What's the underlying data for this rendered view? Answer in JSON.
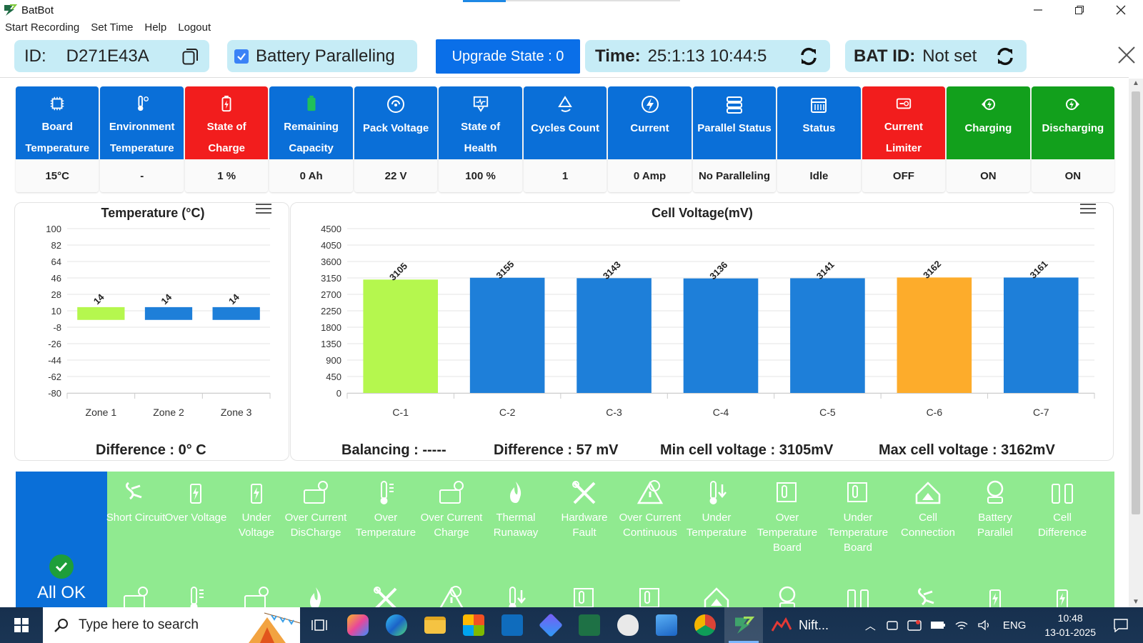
{
  "window": {
    "title": "BatBot"
  },
  "menu": [
    "Start Recording",
    "Set Time",
    "Help",
    "Logout"
  ],
  "header": {
    "id_label": "ID:",
    "id_value": "D271E43A",
    "battery_paralleling": "Battery Paralleling",
    "upgrade_state": "Upgrade State : 0",
    "time_label": "Time:",
    "time_value": "25:1:13 10:44:5",
    "bat_id_label": "BAT ID:",
    "bat_id_value": "Not set"
  },
  "tiles": [
    {
      "label1": "Board",
      "label2": "Temperature",
      "value": "15°C",
      "color": "#0a6fd8",
      "icon": "board-temperature-icon"
    },
    {
      "label1": "Environment",
      "label2": "Temperature",
      "value": "-",
      "color": "#0a6fd8",
      "icon": "environment-temperature-icon"
    },
    {
      "label1": "State of",
      "label2": "Charge",
      "value": "1 %",
      "color": "#f21d1d",
      "icon": "state-of-charge-icon"
    },
    {
      "label1": "Remaining",
      "label2": "Capacity",
      "value": "0 Ah",
      "color": "#0a6fd8",
      "icon": "remaining-capacity-icon"
    },
    {
      "label1": "Pack Voltage",
      "label2": "",
      "value": "22 V",
      "color": "#0a6fd8",
      "icon": "pack-voltage-icon"
    },
    {
      "label1": "State of",
      "label2": "Health",
      "value": "100 %",
      "color": "#0a6fd8",
      "icon": "state-of-health-icon"
    },
    {
      "label1": "Cycles Count",
      "label2": "",
      "value": "1",
      "color": "#0a6fd8",
      "icon": "cycles-count-icon"
    },
    {
      "label1": "Current",
      "label2": "",
      "value": "0 Amp",
      "color": "#0a6fd8",
      "icon": "current-icon"
    },
    {
      "label1": "Parallel Status",
      "label2": "",
      "value": "No Paralleling",
      "color": "#0a6fd8",
      "icon": "parallel-status-icon"
    },
    {
      "label1": "Status",
      "label2": "",
      "value": "Idle",
      "color": "#0a6fd8",
      "icon": "status-icon"
    },
    {
      "label1": "Current",
      "label2": "Limiter",
      "value": "OFF",
      "color": "#f21d1d",
      "icon": "current-limiter-icon"
    },
    {
      "label1": "Charging",
      "label2": "",
      "value": "ON",
      "color": "#12a01c",
      "icon": "charging-icon"
    },
    {
      "label1": "Discharging",
      "label2": "",
      "value": "ON",
      "color": "#12a01c",
      "icon": "discharging-icon"
    }
  ],
  "chart_data": [
    {
      "type": "bar",
      "title": "Temperature (°C)",
      "categories": [
        "Zone 1",
        "Zone 2",
        "Zone 3"
      ],
      "values": [
        14,
        14,
        14
      ],
      "colors": [
        "#b5f74e",
        "#1e7fd9",
        "#1e7fd9"
      ],
      "yticks": [
        100,
        82,
        64,
        46,
        28,
        10,
        -8,
        -26,
        -44,
        -62,
        -80
      ],
      "ylim": [
        -80,
        100
      ],
      "grid": true
    },
    {
      "type": "bar",
      "title": "Cell Voltage(mV)",
      "categories": [
        "C-1",
        "C-2",
        "C-3",
        "C-4",
        "C-5",
        "C-6",
        "C-7"
      ],
      "values": [
        3105,
        3155,
        3143,
        3136,
        3141,
        3162,
        3161
      ],
      "colors": [
        "#b5f74e",
        "#1e7fd9",
        "#1e7fd9",
        "#1e7fd9",
        "#1e7fd9",
        "#fdac2b",
        "#1e7fd9"
      ],
      "yticks": [
        4500,
        4050,
        3600,
        3150,
        2700,
        2250,
        1800,
        1350,
        900,
        450,
        0
      ],
      "ylim": [
        0,
        4500
      ],
      "grid": true
    }
  ],
  "stats": {
    "temp_difference": "Difference : 0° C",
    "balancing": "Balancing : -----",
    "cell_difference": "Difference : 57 mV",
    "min_cell": "Min cell voltage : 3105mV",
    "max_cell": "Max cell voltage : 3162mV"
  },
  "alarms": {
    "all_ok": "All OK",
    "items": [
      {
        "label": "Short Circuit",
        "icon": "short-circuit-icon"
      },
      {
        "label": "Over Voltage",
        "icon": "over-voltage-icon"
      },
      {
        "label": "Under Voltage",
        "icon": "under-voltage-icon"
      },
      {
        "label": "Over Current DisCharge",
        "icon": "over-current-discharge-icon"
      },
      {
        "label": "Over Temperature",
        "icon": "over-temperature-icon"
      },
      {
        "label": "Over Current Charge",
        "icon": "over-current-charge-icon"
      },
      {
        "label": "Thermal Runaway",
        "icon": "thermal-runaway-icon"
      },
      {
        "label": "Hardware Fault",
        "icon": "hardware-fault-icon"
      },
      {
        "label": "Over Current Continuous",
        "icon": "over-current-continuous-icon"
      },
      {
        "label": "Under Temperature",
        "icon": "under-temperature-icon"
      },
      {
        "label": "Over Temperature Board",
        "icon": "over-temperature-board-icon"
      },
      {
        "label": "Under Temperature Board",
        "icon": "under-temperature-board-icon"
      },
      {
        "label": "Cell Connection",
        "icon": "cell-connection-icon"
      },
      {
        "label": "Battery Parallel",
        "icon": "battery-parallel-icon"
      },
      {
        "label": "Cell Difference",
        "icon": "cell-difference-icon"
      }
    ]
  },
  "taskbar": {
    "search_placeholder": "Type here to search",
    "nifty_label": "Nift...",
    "language": "ENG",
    "time": "10:48",
    "date": "13-01-2025"
  }
}
